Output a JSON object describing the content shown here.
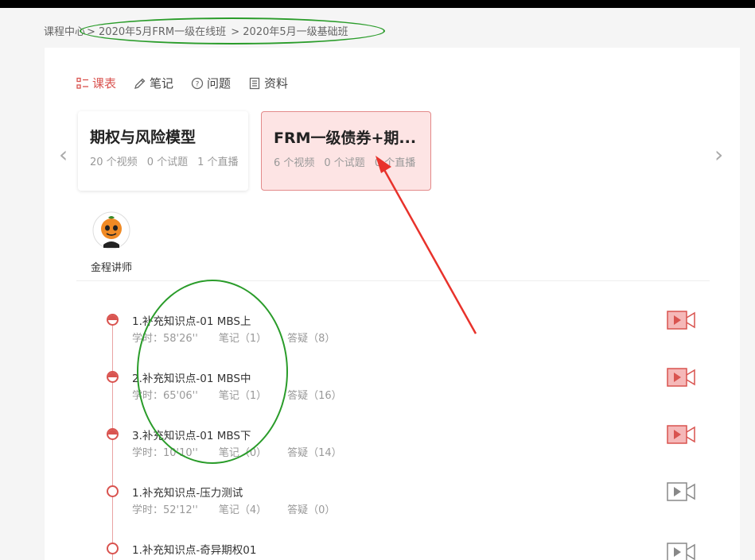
{
  "breadcrumb": [
    "课程中心",
    "> 2020年5月FRM一级在线班",
    "> 2020年5月一级基础班"
  ],
  "tabs": [
    {
      "label": "课表",
      "icon": "schedule-icon",
      "active": true
    },
    {
      "label": "笔记",
      "icon": "pencil-icon",
      "active": false
    },
    {
      "label": "问题",
      "icon": "question-icon",
      "active": false
    },
    {
      "label": "资料",
      "icon": "document-icon",
      "active": false
    }
  ],
  "nav": {
    "prev": "‹",
    "next": "›"
  },
  "courses": [
    {
      "title": "期权与风险模型",
      "videos": "20 个视频",
      "quizzes": "0 个试题",
      "lives": "1 个直播"
    },
    {
      "title": "FRM一级债券+期...",
      "videos": "6 个视频",
      "quizzes": "0 个试题",
      "lives": "0 个直播"
    }
  ],
  "teacher": {
    "name": "金程讲师"
  },
  "lessons": [
    {
      "title": "1.补充知识点-01 MBS上",
      "hours": "学时：58'26''",
      "notes": "笔记（1）",
      "qa": "答疑（8）",
      "status": "half",
      "video": "active"
    },
    {
      "title": "2.补充知识点-01 MBS中",
      "hours": "学时：65'06''",
      "notes": "笔记（1）",
      "qa": "答疑（16）",
      "status": "half",
      "video": "active"
    },
    {
      "title": "3.补充知识点-01 MBS下",
      "hours": "学时：10'10''",
      "notes": "笔记（0）",
      "qa": "答疑（14）",
      "status": "half",
      "video": "active"
    },
    {
      "title": "1.补充知识点-压力测试",
      "hours": "学时：52'12''",
      "notes": "笔记（4）",
      "qa": "答疑（0）",
      "status": "empty",
      "video": "inactive"
    },
    {
      "title": "1.补充知识点-奇异期权01",
      "hours": "",
      "notes": "",
      "qa": "",
      "status": "empty",
      "video": "inactive"
    }
  ],
  "colors": {
    "accent": "#d9534f",
    "annotation_green": "#2a9c2a",
    "annotation_red": "#e8322b"
  }
}
